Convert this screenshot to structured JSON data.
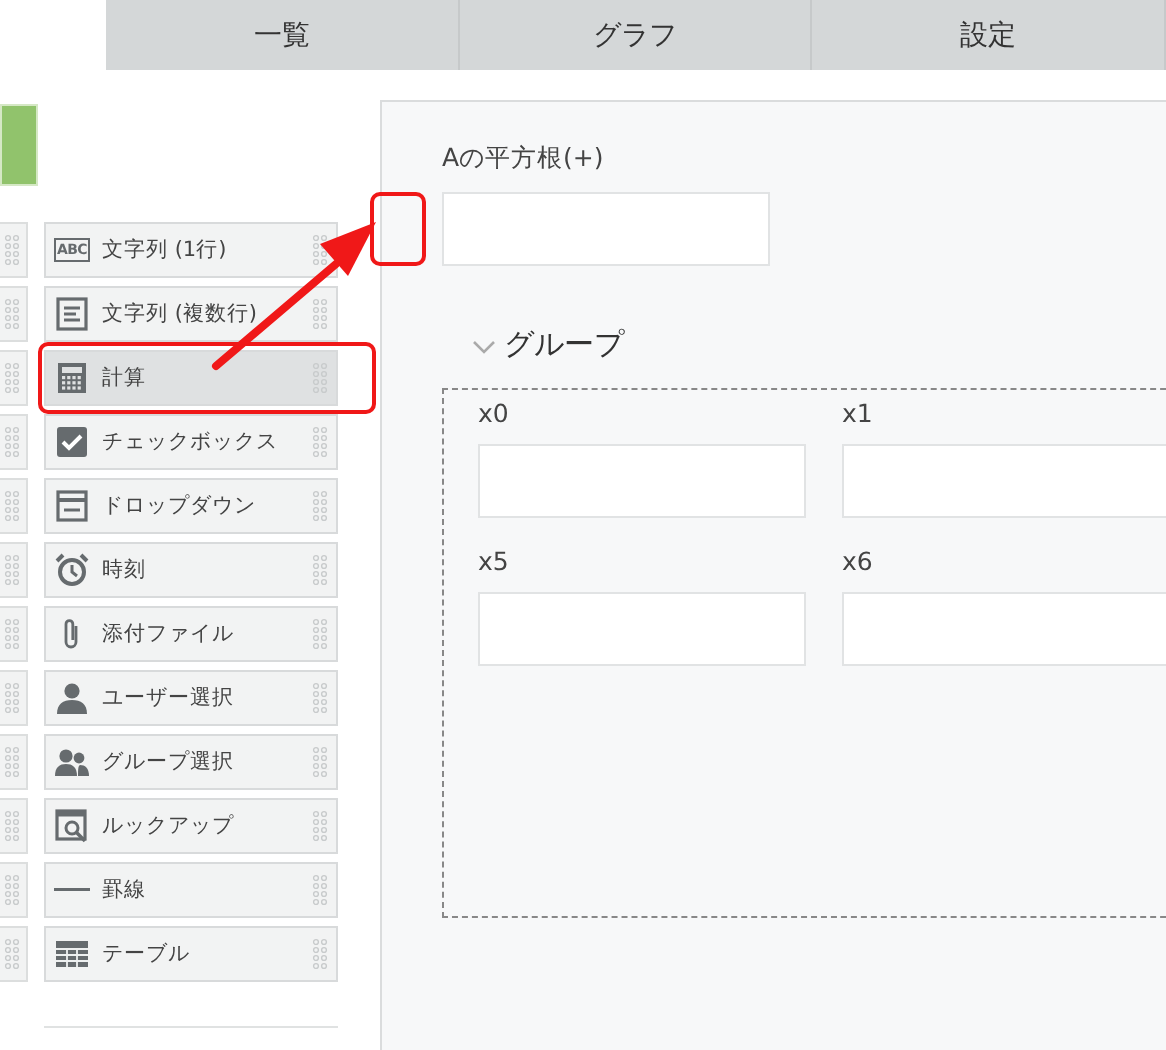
{
  "tabs": [
    {
      "label": "一覧",
      "selected": false
    },
    {
      "label": "グラフ",
      "selected": false
    },
    {
      "label": "設定",
      "selected": false
    }
  ],
  "palette": {
    "items": [
      {
        "label": "文字列 (1行)",
        "kind": "single-line",
        "icon_text": "ABC",
        "selected": false
      },
      {
        "label": "文字列 (複数行)",
        "kind": "multi-line",
        "selected": false
      },
      {
        "label": "計算",
        "kind": "calc",
        "selected": true
      },
      {
        "label": "チェックボックス",
        "kind": "checkbox",
        "selected": false
      },
      {
        "label": "ドロップダウン",
        "kind": "dropdown",
        "selected": false
      },
      {
        "label": "時刻",
        "kind": "time",
        "selected": false
      },
      {
        "label": "添付ファイル",
        "kind": "file",
        "selected": false
      },
      {
        "label": "ユーザー選択",
        "kind": "user",
        "selected": false
      },
      {
        "label": "グループ選択",
        "kind": "group",
        "selected": false
      },
      {
        "label": "ルックアップ",
        "kind": "lookup",
        "selected": false
      },
      {
        "label": "罫線",
        "kind": "rule",
        "selected": false
      },
      {
        "label": "テーブル",
        "kind": "table",
        "selected": false
      }
    ]
  },
  "form": {
    "fields": [
      {
        "label": "Aの平方根(+)",
        "highlighted": true
      }
    ],
    "group": {
      "title": "グループ",
      "expanded": true,
      "fields": [
        {
          "label": "x0"
        },
        {
          "label": "x1"
        },
        {
          "label": "x5"
        },
        {
          "label": "x6"
        }
      ]
    }
  }
}
